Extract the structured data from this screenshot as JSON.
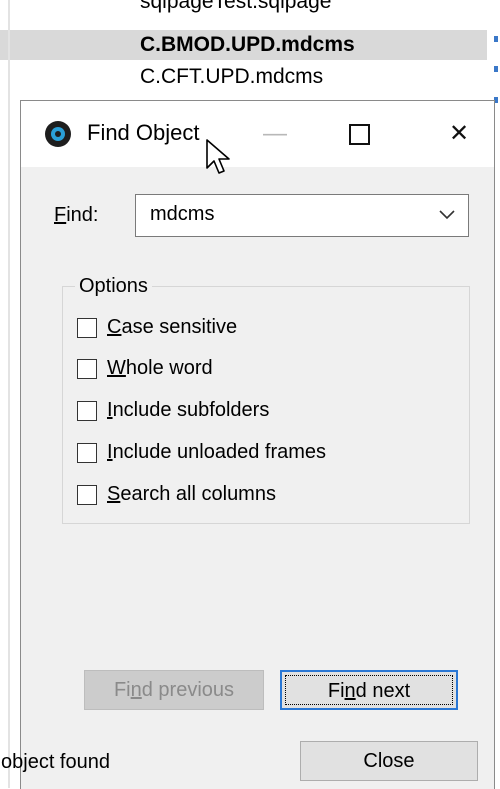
{
  "list": {
    "rows": [
      "sqlpageTest.sqlpage",
      "C.BMOD.UPD.mdcms",
      "C.CFT.UPD.mdcms"
    ]
  },
  "dialog": {
    "title": "Find Object",
    "controls": {
      "minimize": "—",
      "close": "✕"
    },
    "find_label_pre": "",
    "find_label_key": "F",
    "find_label_post": "ind:",
    "find_value": "mdcms",
    "options_legend": "Options",
    "options": [
      {
        "key": "C",
        "rest": "ase sensitive",
        "checked": false
      },
      {
        "key": "W",
        "rest": "hole word",
        "checked": false
      },
      {
        "key": "I",
        "rest": "nclude subfolders",
        "checked": false
      },
      {
        "key": "I",
        "rest": "nclude unloaded frames",
        "checked": false
      },
      {
        "key": "S",
        "rest": "earch all columns",
        "checked": false
      }
    ],
    "find_previous": {
      "pre": "Fi",
      "key": "n",
      "post": "d previous"
    },
    "find_next": {
      "pre": "Fi",
      "key": "n",
      "post": "d next"
    },
    "close_button": "Close",
    "status": "object found"
  },
  "colors": {
    "accent": "#2a77d4",
    "selected_row": "#d9d9d9",
    "dialog_bg": "#f0f0f0"
  }
}
